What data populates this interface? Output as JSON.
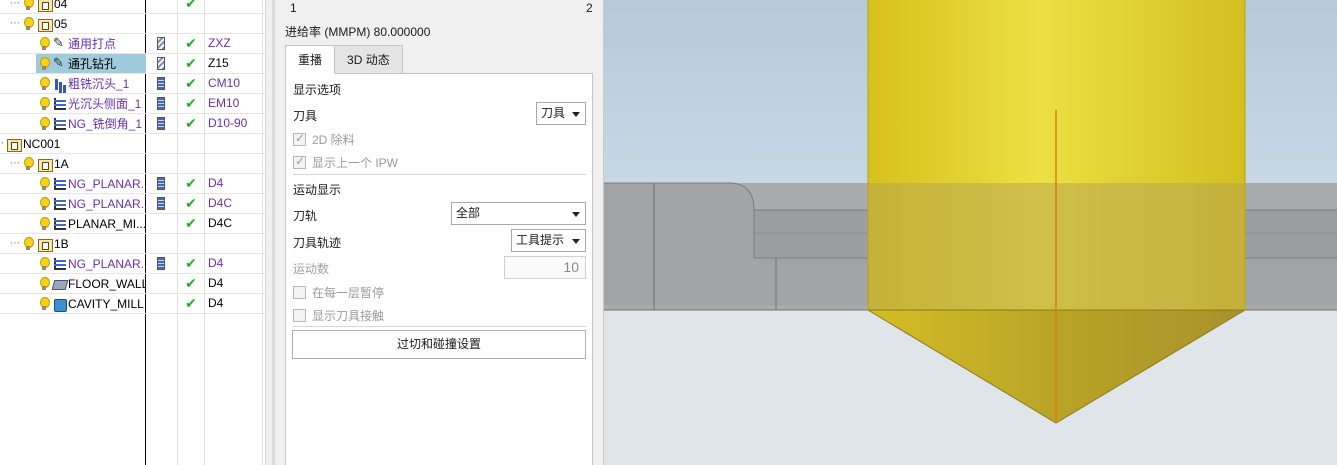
{
  "navigator": {
    "rows": [
      {
        "label": "04",
        "indent": 1,
        "kind": "group",
        "name_color": "#000000",
        "tool": "",
        "status": true,
        "tool_state": "",
        "selected": false
      },
      {
        "label": "05",
        "indent": 1,
        "kind": "group",
        "name_color": "#000000",
        "tool": "",
        "status": false,
        "tool_state": "",
        "selected": false
      },
      {
        "label": "通用打点",
        "indent": 2,
        "kind": "drill",
        "name_color": "purple",
        "tool": "ZXZ",
        "status": true,
        "tool_state": "hatched",
        "selected": false
      },
      {
        "label": "通孔钻孔",
        "indent": 2,
        "kind": "drill",
        "name_color": "black",
        "tool": "Z15",
        "status": true,
        "tool_state": "hatched",
        "selected": true
      },
      {
        "label": "粗铣沉头_1",
        "indent": 2,
        "kind": "mill",
        "name_color": "purple",
        "tool": "CM10",
        "status": true,
        "tool_state": "dark",
        "selected": false
      },
      {
        "label": "光沉头侧面_1",
        "indent": 2,
        "kind": "planar",
        "name_color": "purple",
        "tool": "EM10",
        "status": true,
        "tool_state": "dark",
        "selected": false
      },
      {
        "label": "NG_铣倒角_1",
        "indent": 2,
        "kind": "planar",
        "name_color": "purple",
        "tool": "D10-90",
        "status": true,
        "tool_state": "dark",
        "selected": false
      },
      {
        "label": "NC001",
        "indent": 0,
        "kind": "group",
        "name_color": "black",
        "tool": "",
        "status": false,
        "tool_state": "",
        "selected": false
      },
      {
        "label": "1A",
        "indent": 1,
        "kind": "group",
        "name_color": "black",
        "tool": "",
        "status": false,
        "tool_state": "",
        "selected": false
      },
      {
        "label": "NG_PLANAR...",
        "indent": 2,
        "kind": "planar",
        "name_color": "purple",
        "tool": "D4",
        "status": true,
        "tool_state": "dark",
        "selected": false
      },
      {
        "label": "NG_PLANAR...",
        "indent": 2,
        "kind": "planar",
        "name_color": "purple",
        "tool": "D4C",
        "status": true,
        "tool_state": "dark",
        "selected": false
      },
      {
        "label": "PLANAR_MI...",
        "indent": 2,
        "kind": "planar",
        "name_color": "black",
        "tool": "D4C",
        "status": true,
        "tool_state": "",
        "selected": false
      },
      {
        "label": "1B",
        "indent": 1,
        "kind": "group",
        "name_color": "black",
        "tool": "",
        "status": false,
        "tool_state": "",
        "selected": false
      },
      {
        "label": "NG_PLANAR...",
        "indent": 2,
        "kind": "planar",
        "name_color": "purple",
        "tool": "D4",
        "status": true,
        "tool_state": "dark",
        "selected": false
      },
      {
        "label": "FLOOR_WALL",
        "indent": 2,
        "kind": "floor",
        "name_color": "black",
        "tool": "D4",
        "status": true,
        "tool_state": "",
        "selected": false
      },
      {
        "label": "CAVITY_MILL",
        "indent": 2,
        "kind": "cavity",
        "name_color": "black",
        "tool": "D4",
        "status": true,
        "tool_state": "",
        "selected": false
      }
    ]
  },
  "panel": {
    "slider_min": "1",
    "slider_max": "2",
    "feed_rate": "进给率 (MMPM) 80.000000",
    "tabs": [
      {
        "label": "重播",
        "active": true
      },
      {
        "label": "3D 动态",
        "active": false
      }
    ],
    "display_options": {
      "section_label": "显示选项",
      "tool_label": "刀具",
      "tool_value": "刀具",
      "chk_2d_label": "2D 除料",
      "chk_2d": true,
      "chk_ipw_label": "显示上一个 IPW",
      "chk_ipw": true
    },
    "motion_display": {
      "section_label": "运动显示",
      "path_label": "刀轨",
      "path_value": "全部",
      "trace_label": "刀具轨迹",
      "trace_value": "工具提示",
      "count_label": "运动数",
      "count_value": "10",
      "chk_pause_label": "在每一层暂停",
      "chk_pause": false,
      "chk_contact_label": "显示刀具接触",
      "chk_contact": false
    },
    "collision_button": "过切和碰撞设置"
  },
  "colors": {
    "tool_yellow": "#e8d534",
    "path_orange": "#e07a18",
    "status_green": "#23b023",
    "selection_blue": "#9fcbdc",
    "purple_text": "#6a2fb5"
  }
}
